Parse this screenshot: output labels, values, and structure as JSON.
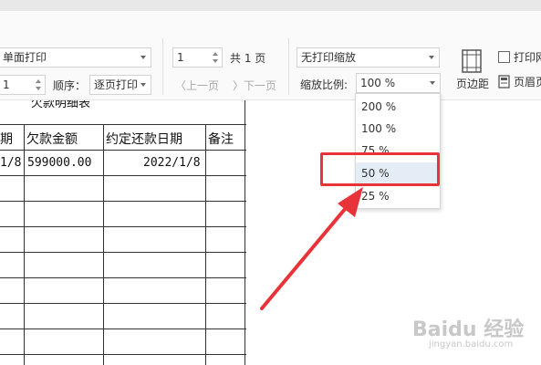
{
  "ribbon": {
    "print_side": "单面打印",
    "copies": "1",
    "order_label": "顺序：",
    "order_value": "逐页打印",
    "page_input": "1",
    "page_total": "共 1 页",
    "prev_page": "上一页",
    "next_page": "下一页",
    "scaling_mode": "无打印缩放",
    "zoom_label": "缩放比例:",
    "zoom_value": "100 %",
    "margins_label": "页边距",
    "print_grid_label": "打印网",
    "header_footer_label": "页眉页"
  },
  "sheet": {
    "title_fragment": "欠款明细表",
    "headers": [
      "期",
      "欠款金额",
      "约定还款日期",
      "备注"
    ],
    "row1": [
      "1/8",
      "599000.00",
      "2022/1/8",
      ""
    ]
  },
  "zoom_dropdown": {
    "options": [
      "200 %",
      "100 %",
      "75 %",
      "50 %",
      "25 %"
    ],
    "selected": "50 %"
  },
  "watermark": {
    "text": "Baidu 经验",
    "sub": "jingyan.baidu.com"
  },
  "colors": {
    "highlight": "#e8333a",
    "selection": "#e4ecf6"
  }
}
